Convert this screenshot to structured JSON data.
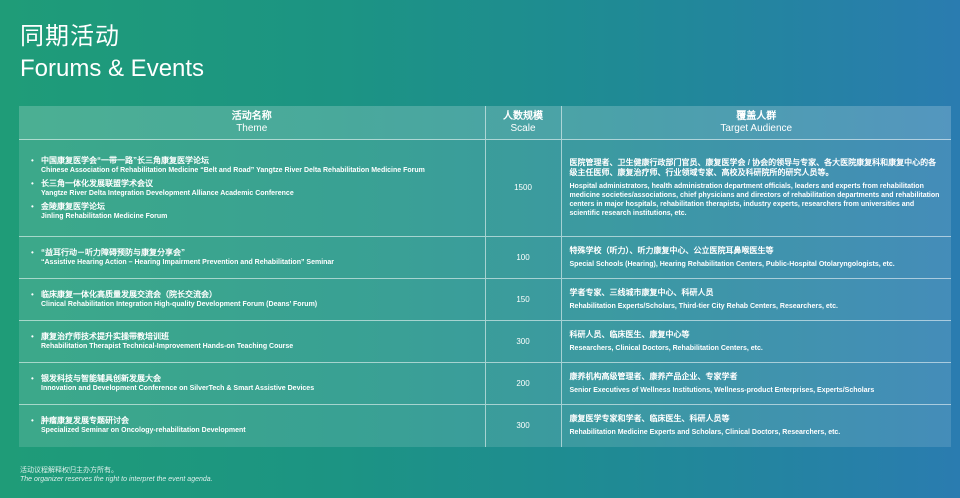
{
  "header": {
    "title_cn": "同期活动",
    "title_en": "Forums & Events"
  },
  "table": {
    "columns": [
      {
        "cn": "活动名称",
        "en": "Theme"
      },
      {
        "cn": "人数规模",
        "en": "Scale"
      },
      {
        "cn": "覆盖人群",
        "en": "Target Audience"
      }
    ],
    "rows": [
      {
        "themes": [
          {
            "cn": "中国康复医学会“一带一路”长三角康复医学论坛",
            "en": "Chinese Association of Rehabilitation Medicine “Belt and Road” Yangtze River Delta Rehabilitation Medicine Forum"
          },
          {
            "cn": "长三角一体化发展联盟学术会议",
            "en": "Yangtze River Delta Integration Development Alliance Academic Conference"
          },
          {
            "cn": "金陵康复医学论坛",
            "en": "Jinling Rehabilitation Medicine Forum"
          }
        ],
        "scale": "1500",
        "audience_cn": "医院管理者、卫生健康行政部门官员、康复医学会 / 协会的领导与专家、各大医院康复科和康复中心的各级主任医师、康复治疗师、行业领域专家、高校及科研院所的研究人员等。",
        "audience_en": "Hospital administrators, health administration department officials, leaders and experts from rehabilitation medicine societies/associations, chief physicians and directors of rehabilitation departments and rehabilitation centers in major hospitals, rehabilitation therapists, industry experts, researchers from universities and scientific research institutions, etc."
      },
      {
        "themes": [
          {
            "cn": "“益耳行动－听力障碍预防与康复分享会”",
            "en": "“Assistive Hearing Action – Hearing Impairment Prevention and Rehabilitation” Seminar"
          }
        ],
        "scale": "100",
        "audience_cn": "特殊学校（听力）、听力康复中心、公立医院耳鼻喉医生等",
        "audience_en": "Special Schools (Hearing), Hearing Rehabilitation Centers, Public-Hospital Otolaryngologists, etc."
      },
      {
        "themes": [
          {
            "cn": "临床康复一体化高质量发展交流会（院长交流会）",
            "en": "Clinical Rehabilitation Integration High-quality Development Forum (Deans’ Forum)"
          }
        ],
        "scale": "150",
        "audience_cn": "学者专家、三线城市康复中心、科研人员",
        "audience_en": "Rehabilitation Experts/Scholars, Third-tier City Rehab Centers, Researchers, etc."
      },
      {
        "themes": [
          {
            "cn": "康复治疗师技术提升实操带教培训班",
            "en": "Rehabilitation Therapist Technical-Improvement Hands-on Teaching Course"
          }
        ],
        "scale": "300",
        "audience_cn": "科研人员、临床医生、康复中心等",
        "audience_en": "Researchers, Clinical Doctors, Rehabilitation Centers, etc."
      },
      {
        "themes": [
          {
            "cn": "银发科技与智能辅具创新发展大会",
            "en": "Innovation and Development Conference on SilverTech & Smart Assistive Devices"
          }
        ],
        "scale": "200",
        "audience_cn": "康养机构高级管理者、康养产品企业、专家学者",
        "audience_en": "Senior Executives of Wellness Institutions, Wellness-product Enterprises, Experts/Scholars"
      },
      {
        "themes": [
          {
            "cn": "肿瘤康复发展专题研讨会",
            "en": "Specialized Seminar on Oncology-rehabilitation Development"
          }
        ],
        "scale": "300",
        "audience_cn": "康复医学专家和学者、临床医生、科研人员等",
        "audience_en": "Rehabilitation Medicine Experts and Scholars, Clinical Doctors, Researchers, etc."
      }
    ]
  },
  "footer": {
    "note_cn": "活动议程解释权归主办方所有。",
    "note_en": "The organizer reserves the right to interpret the event agenda."
  },
  "colors": {
    "bg_left": "#1f9c78",
    "bg_right": "#2a7cb0",
    "text": "#ffffff"
  }
}
